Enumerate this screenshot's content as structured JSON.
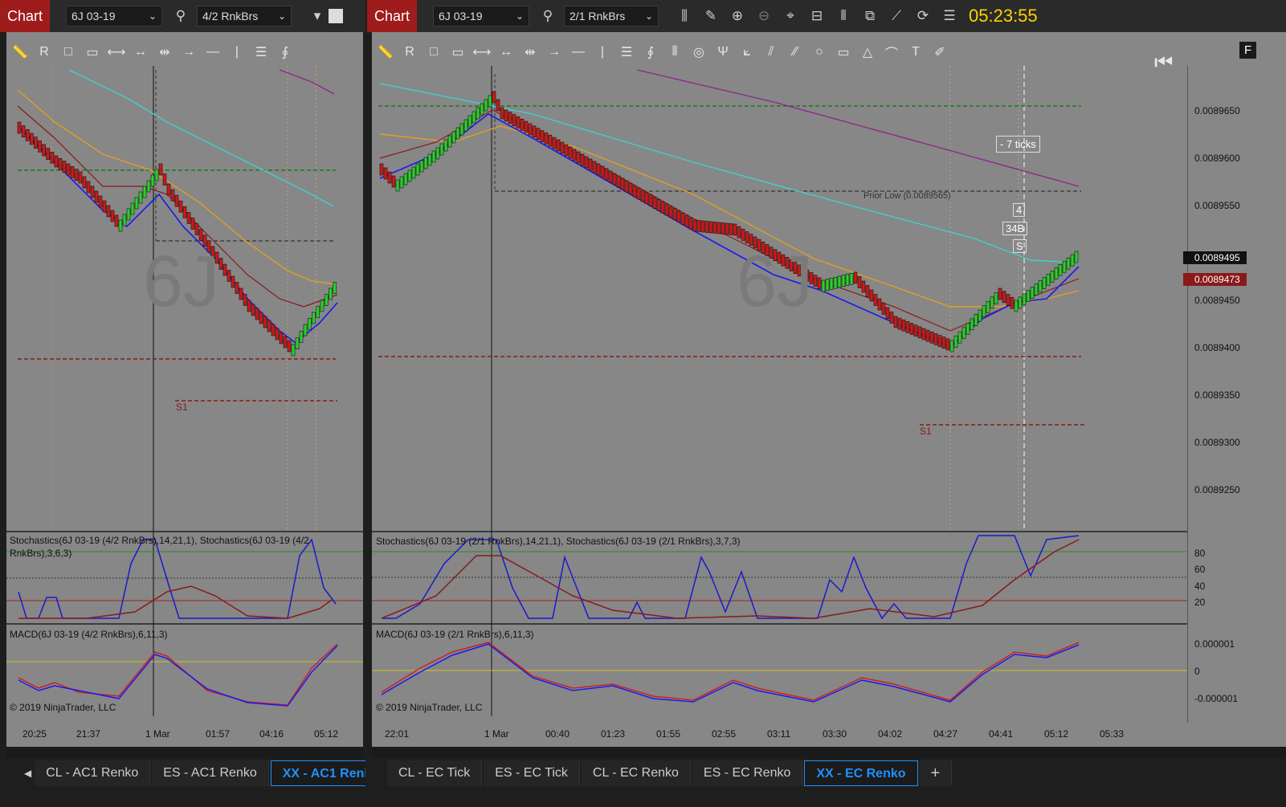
{
  "left": {
    "chart_button": "Chart",
    "instrument": "6J 03-19",
    "bar_type": "4/2 RnkBrs",
    "watermark": "6J",
    "stoch_label": "Stochastics(6J 03-19 (4/2 RnkBrs),14,21,1), Stochastics(6J 03-19 (4/2 RnkBrs),3,6,3)",
    "macd_label": "MACD(6J 03-19 (4/2 RnkBrs),6,11,3)",
    "copyright": "© 2019 NinjaTrader, LLC",
    "time_ticks": [
      "20:25",
      "21:37",
      "1 Mar",
      "01:57",
      "04:16",
      "05:12"
    ],
    "s1": "S1"
  },
  "right": {
    "chart_button": "Chart",
    "instrument": "6J 03-19",
    "bar_type": "2/1 RnkBrs",
    "clock": "05:23:55",
    "watermark": "6J",
    "ticks_label": "- 7 ticks",
    "prior_low": "Prior Low (0.0089565)",
    "flags": [
      "4",
      "34B",
      "S"
    ],
    "price_ticks": [
      "0.0089650",
      "0.0089600",
      "0.0089550",
      "0.0089450",
      "0.0089400",
      "0.0089350",
      "0.0089300",
      "0.0089250"
    ],
    "last_price": "0.0089495",
    "bid_price": "0.0089473",
    "stoch_label": "Stochastics(6J 03-19 (2/1 RnkBrs),14,21,1), Stochastics(6J 03-19 (2/1 RnkBrs),3,7,3)",
    "stoch_ticks": [
      "80",
      "60",
      "40",
      "20"
    ],
    "macd_label": "MACD(6J 03-19 (2/1 RnkBrs),6,11,3)",
    "macd_ticks": [
      "0.000001",
      "0",
      "-0.000001"
    ],
    "copyright": "© 2019 NinjaTrader, LLC",
    "time_ticks": [
      "22:01",
      "1 Mar",
      "00:40",
      "01:23",
      "01:55",
      "02:55",
      "03:11",
      "03:30",
      "04:02",
      "04:27",
      "04:41",
      "05:12",
      "05:33"
    ],
    "s1": "S1",
    "corner_letter": "F"
  },
  "tabs_left": [
    "CL - AC1 Renko",
    "ES - AC1 Renko",
    "XX - AC1 Renk"
  ],
  "tabs_right": [
    "CL - EC Tick",
    "ES - EC Tick",
    "CL - EC Renko",
    "ES - EC Renko",
    "XX - EC Renko"
  ],
  "colors": {
    "up_bar": "#2ecc2e",
    "down_bar": "#cc1a1a",
    "clock": "#ffd200",
    "active_tab": "#1e90ff"
  }
}
